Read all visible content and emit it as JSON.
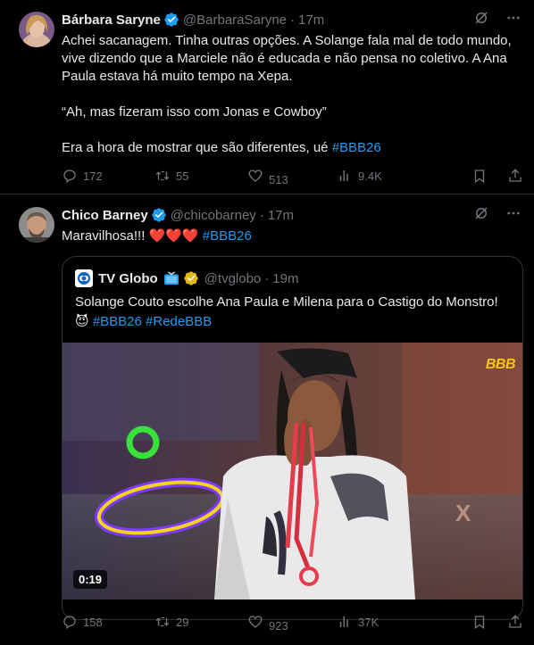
{
  "tweets": [
    {
      "author": "Bárbara Saryne",
      "handle": "@BarbaraSaryne",
      "time": "17m",
      "text_p1": "Achei sacanagem. Tinha outras opções. A Solange fala mal de todo mundo, vive dizendo que a Marciele não é educada e não pensa no coletivo. A Ana Paula estava há muito tempo na Xepa.",
      "text_p2": "“Ah, mas fizeram isso com Jonas e Cowboy”",
      "text_p3": "Era a hora de mostrar que são diferentes, ué",
      "hashtag": "#BBB26",
      "stats": {
        "replies": "172",
        "reposts": "55",
        "likes": "513",
        "views": "9.4K"
      }
    },
    {
      "author": "Chico Barney",
      "handle": "@chicobarney",
      "time": "17m",
      "text": "Maravilhosa!!!",
      "hearts": "❤️❤️❤️",
      "hashtag": "#BBB26",
      "stats": {
        "replies": "158",
        "reposts": "29",
        "likes": "923",
        "views": "37K"
      },
      "quote": {
        "author": "TV Globo",
        "handle": "@tvglobo",
        "time": "19m",
        "text": "Solange Couto escolhe Ana Paula e Milena para o Castigo do Monstro!",
        "emoji": "😈",
        "hashtags": "#BBB26 #RedeBBB",
        "video_duration": "0:19",
        "video_logo": "BBB"
      }
    }
  ],
  "separator": "·",
  "icons": [
    "verified-badge-icon",
    "grok-icon",
    "more-icon",
    "reply-icon",
    "repost-icon",
    "like-icon",
    "views-icon",
    "bookmark-icon",
    "share-icon",
    "tv-icon",
    "gold-badge-icon",
    "globo-logo-icon"
  ],
  "colors": {
    "background": "#000000",
    "text": "#e7e9ea",
    "muted": "#71767b",
    "accent": "#1d9bf0",
    "border": "#2f3336",
    "gold": "#e2b719"
  }
}
